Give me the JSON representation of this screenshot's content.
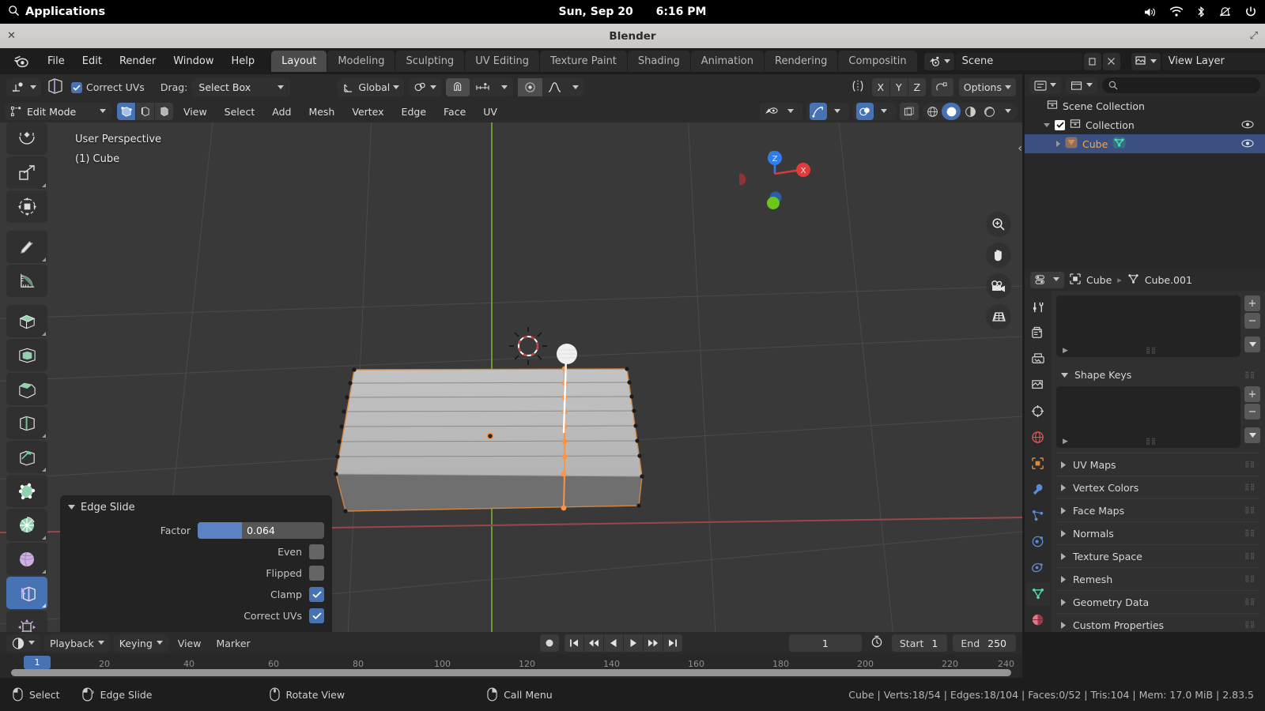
{
  "os": {
    "applications_label": "Applications",
    "date": "Sun, Sep 20",
    "time": "6:16 PM"
  },
  "window": {
    "title": "Blender"
  },
  "topbar": {
    "menus": [
      "File",
      "Edit",
      "Render",
      "Window",
      "Help"
    ],
    "workspaces": [
      "Layout",
      "Modeling",
      "Sculpting",
      "UV Editing",
      "Texture Paint",
      "Shading",
      "Animation",
      "Rendering",
      "Compositin"
    ],
    "active_workspace": "Layout",
    "scene_name": "Scene",
    "view_layer_name": "View Layer"
  },
  "tool_settings": {
    "correct_uvs_label": "Correct UVs",
    "correct_uvs_checked": true,
    "drag_label": "Drag:",
    "drag_value": "Select Box",
    "transform_orientation": "Global",
    "axis_locks": [
      "X",
      "Y",
      "Z"
    ],
    "options_label": "Options"
  },
  "viewport_header": {
    "mode": "Edit Mode",
    "menus": [
      "View",
      "Select",
      "Add",
      "Mesh",
      "Vertex",
      "Edge",
      "Face",
      "UV"
    ]
  },
  "viewport": {
    "perspective_label": "User Perspective",
    "object_label": "(1) Cube",
    "gizmo_axes": [
      "X",
      "Z"
    ],
    "accent_orange": "#ff9340",
    "accent_blue": "#4772b3",
    "background": "#393939"
  },
  "operator_panel": {
    "title": "Edge Slide",
    "factor_label": "Factor",
    "factor_value": "0.064",
    "factor_fill_percent": 35,
    "rows": [
      {
        "label": "Even",
        "checked": false
      },
      {
        "label": "Flipped",
        "checked": false
      },
      {
        "label": "Clamp",
        "checked": true
      },
      {
        "label": "Correct UVs",
        "checked": true
      }
    ]
  },
  "outliner": {
    "rows": [
      {
        "label": "Scene Collection",
        "type": "scene",
        "indent": 0,
        "selected": false,
        "eye": false
      },
      {
        "label": "Collection",
        "type": "collection",
        "indent": 1,
        "selected": false,
        "eye": true
      },
      {
        "label": "Cube",
        "type": "object",
        "indent": 2,
        "selected": true,
        "eye": true
      }
    ]
  },
  "properties": {
    "breadcrumb_object": "Cube",
    "breadcrumb_data": "Cube.001",
    "shape_keys_label": "Shape Keys",
    "panels": [
      "UV Maps",
      "Vertex Colors",
      "Face Maps",
      "Normals",
      "Texture Space",
      "Remesh",
      "Geometry Data",
      "Custom Properties"
    ]
  },
  "timeline": {
    "playback_label": "Playback",
    "keying_label": "Keying",
    "view_label": "View",
    "marker_label": "Marker",
    "current_frame": "1",
    "start_label": "Start",
    "start_value": "1",
    "end_label": "End",
    "end_value": "250",
    "ticks": [
      "20",
      "40",
      "60",
      "80",
      "100",
      "120",
      "140",
      "160",
      "180",
      "200",
      "220",
      "240"
    ],
    "playhead_frame": "1"
  },
  "statusbar": {
    "hints": [
      {
        "label": "Select",
        "mouse": "left"
      },
      {
        "label": "Edge Slide",
        "mouse": "left-drag"
      },
      {
        "label": "Rotate View",
        "mouse": "middle"
      },
      {
        "label": "Call Menu",
        "mouse": "right"
      }
    ],
    "stats": "Cube | Verts:18/54 | Edges:18/104 | Faces:0/52 | Tris:104 | Mem: 17.0 MiB | 2.83.5"
  }
}
